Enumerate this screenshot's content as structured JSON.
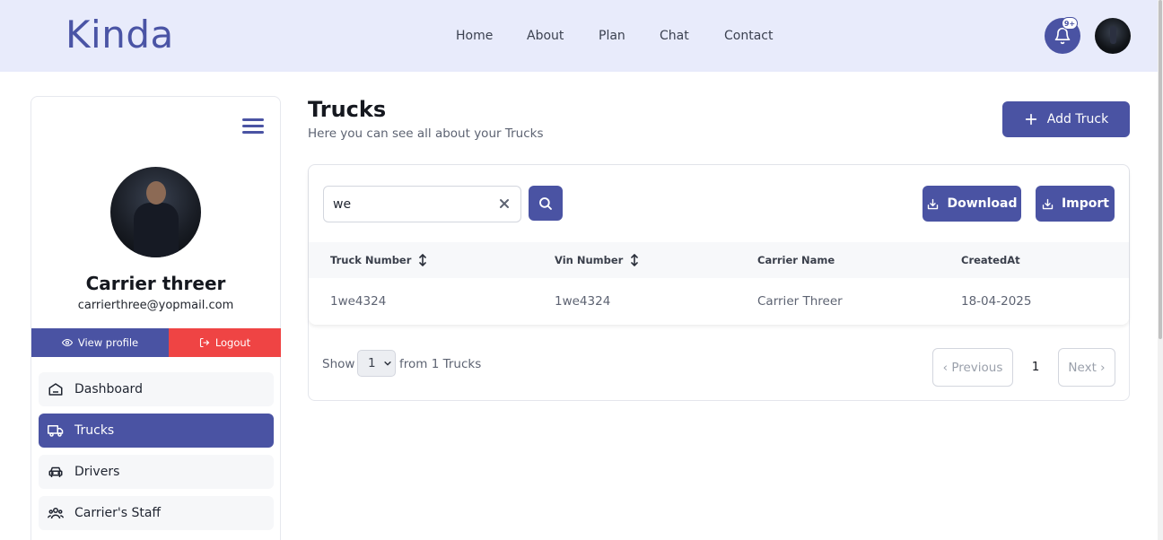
{
  "brand": {
    "name": "Kinda",
    "color": "#4a54a5"
  },
  "nav": {
    "items": [
      "Home",
      "About",
      "Plan",
      "Chat",
      "Contact"
    ]
  },
  "notifications": {
    "badge": "9+",
    "icon": "bell-icon"
  },
  "sidebar": {
    "name": "Carrier threer",
    "email": "carrierthree@yopmail.com",
    "view_profile": "View profile",
    "logout": "Logout",
    "items": [
      {
        "label": "Dashboard",
        "icon": "home-icon",
        "active": false
      },
      {
        "label": "Trucks",
        "icon": "truck-icon",
        "active": true
      },
      {
        "label": "Drivers",
        "icon": "car-icon",
        "active": false
      },
      {
        "label": "Carrier's Staff",
        "icon": "users-icon",
        "active": false
      }
    ]
  },
  "main": {
    "title": "Trucks",
    "subtitle": "Here you can see all about your Trucks",
    "add_button": "Add Truck",
    "search_value": "we",
    "download_label": "Download",
    "import_label": "Import",
    "table": {
      "columns": [
        "Truck Number",
        "Vin Number",
        "Carrier Name",
        "CreatedAt"
      ],
      "rows": [
        [
          "1we4324",
          "1we4324",
          "Carrier Threer",
          "18-04-2025"
        ]
      ]
    },
    "pagination": {
      "show_label": "Show",
      "page_size": "1",
      "from_label": "from 1 Trucks",
      "previous": "‹ Previous",
      "current_page": "1",
      "next": "Next ›"
    }
  },
  "colors": {
    "primary": "#4a53a3",
    "danger": "#ef4444",
    "header_bg": "#e8ebfb"
  }
}
